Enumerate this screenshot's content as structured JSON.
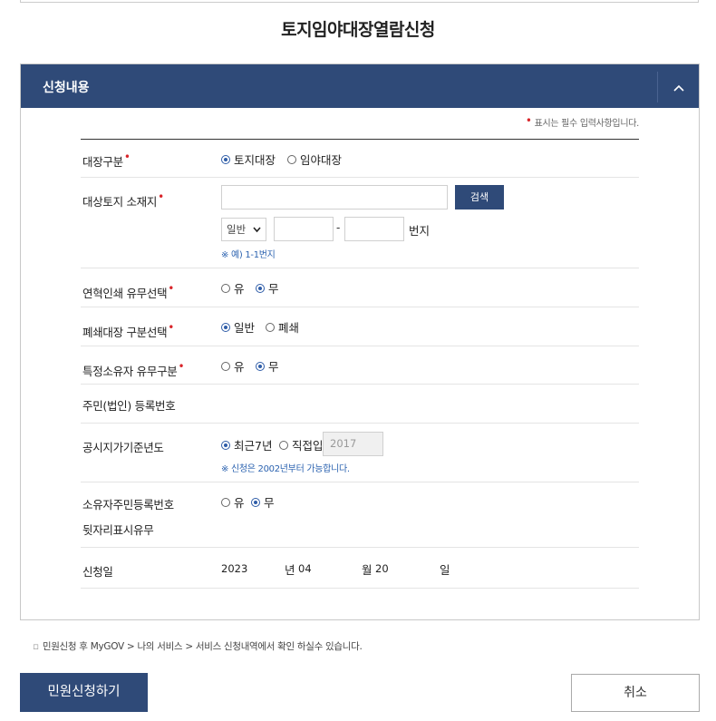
{
  "page_title": "토지임야대장열람신청",
  "panel": {
    "title": "신청내용",
    "toggle_icon": "chevron-up-icon"
  },
  "required_note": "표시는 필수 입력사항입니다.",
  "required_mark": "•",
  "form": {
    "ledger_type": {
      "label": "대장구분",
      "options": [
        "토지대장",
        "임야대장"
      ],
      "selected": "토지대장"
    },
    "location": {
      "label": "대상토지 소재지",
      "address_value": "",
      "search_label": "검색",
      "land_type": "일반",
      "main_number": "",
      "separator": "-",
      "sub_number": "",
      "suffix": "번지",
      "hint": "※ 예) 1-1번지"
    },
    "history_print": {
      "label": "연혁인쇄 유무선택",
      "options": [
        "유",
        "무"
      ],
      "selected": "무"
    },
    "closed_ledger": {
      "label": "폐쇄대장 구분선택",
      "options": [
        "일반",
        "폐쇄"
      ],
      "selected": "일반"
    },
    "specific_owner": {
      "label": "특정소유자 유무구분",
      "options": [
        "유",
        "무"
      ],
      "selected": "무"
    },
    "resident_number": {
      "label": "주민(법인) 등록번호"
    },
    "land_price_year": {
      "label": "공시지가기준년도",
      "options": [
        "최근7년",
        "직접입력"
      ],
      "selected": "최근7년",
      "year_value": "2017",
      "hint": "※ 신청은 2002년부터 가능합니다."
    },
    "owner_id_suffix": {
      "label_line1": "소유자주민등록번호",
      "label_line2": "뒷자리표시유무",
      "options": [
        "유",
        "무"
      ],
      "selected": "무"
    },
    "apply_date": {
      "label": "신청일",
      "year": "2023",
      "year_unit": "년",
      "month": "04",
      "month_unit": "월",
      "day": "20",
      "day_unit": "일"
    }
  },
  "notice": {
    "bullet": "▫",
    "text": "민원신청 후 MyGOV > 나의 서비스 > 서비스 신청내역에서 확인 하실수 있습니다."
  },
  "buttons": {
    "submit": "민원신청하기",
    "cancel": "취소"
  }
}
